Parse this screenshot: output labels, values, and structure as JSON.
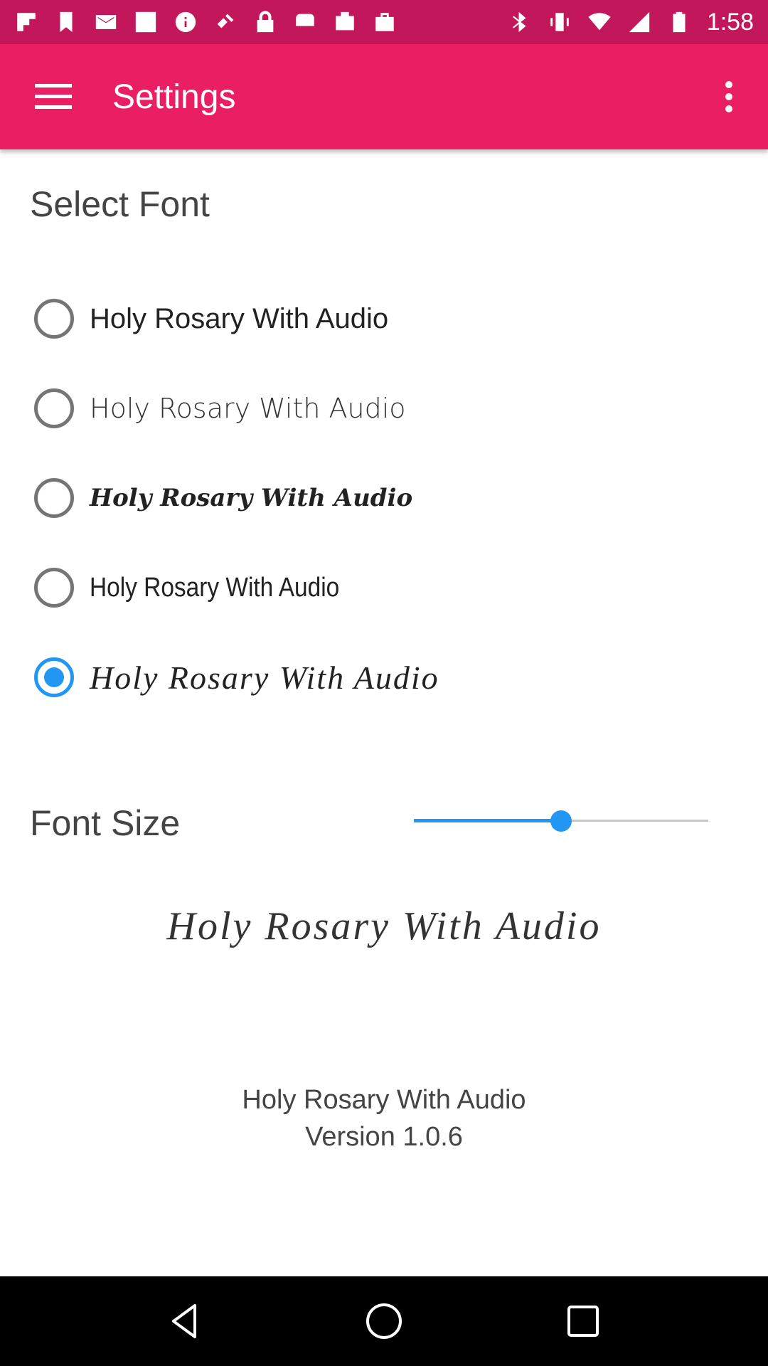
{
  "status_bar": {
    "time": "1:58",
    "left_icons": [
      "flipboard-icon",
      "bookmark-icon",
      "gmail-icon",
      "square-icon",
      "info-icon",
      "satellite-icon",
      "lock-icon",
      "android-icon",
      "task-icon",
      "bag-icon"
    ],
    "right_icons": [
      "bluetooth-icon",
      "vibrate-icon",
      "wifi-icon",
      "signal-icon",
      "battery-icon"
    ]
  },
  "app_bar": {
    "title": "Settings",
    "background": "#e91e63",
    "status_background": "#c2185b"
  },
  "select_font": {
    "title": "Select Font",
    "options": [
      {
        "label": "Holy Rosary With Audio",
        "checked": false
      },
      {
        "label": "Holy Rosary With Audio",
        "checked": false
      },
      {
        "label": "Holy Rosary With Audio",
        "checked": false
      },
      {
        "label": "Holy Rosary With Audio",
        "checked": false
      },
      {
        "label": "Holy Rosary With Audio",
        "checked": true
      }
    ]
  },
  "font_size": {
    "label": "Font Size",
    "slider_value": 0.5,
    "accent": "#2196f3"
  },
  "preview": {
    "text": "Holy Rosary With Audio"
  },
  "about": {
    "app_name": "Holy Rosary With Audio",
    "version": "Version 1.0.6"
  },
  "nav_bar": {
    "buttons": [
      "back-icon",
      "home-icon",
      "recents-icon"
    ]
  }
}
